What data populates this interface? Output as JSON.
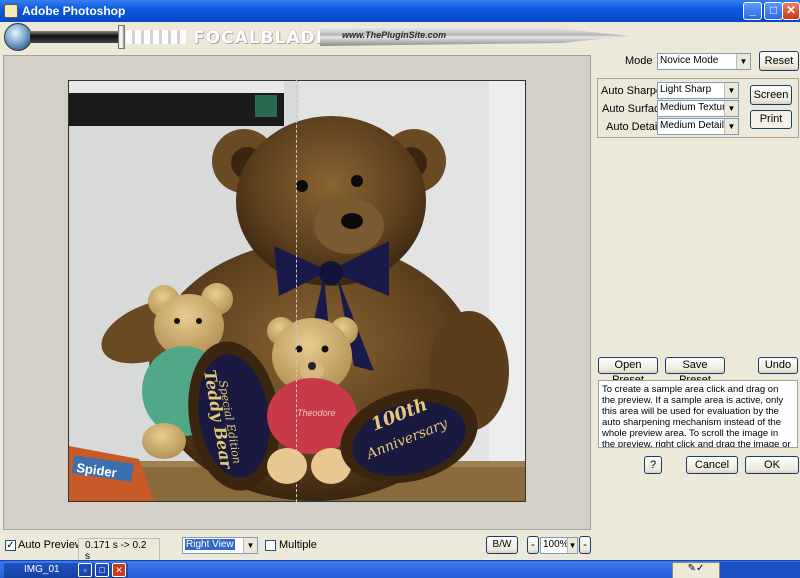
{
  "window": {
    "title": "Adobe Photoshop"
  },
  "banner": {
    "brand": "FOCALBLADE",
    "site": "www.ThePluginSite.com"
  },
  "controls": {
    "mode_label": "Mode",
    "mode_value": "Novice Mode",
    "reset_label": "Reset",
    "auto_sharpen_label": "Auto Sharpen",
    "auto_sharpen_value": "Light Sharp",
    "auto_surface_label": "Auto Surface",
    "auto_surface_value": "Medium Textured",
    "auto_details_label": "Auto Details",
    "auto_details_value": "Medium Details",
    "screen_label": "Screen",
    "print_label": "Print",
    "open_preset_label": "Open Preset",
    "save_preset_label": "Save Preset",
    "undo_label": "Undo",
    "help_label": "?",
    "cancel_label": "Cancel",
    "ok_label": "OK"
  },
  "info_text": "To create a sample area click and drag on the preview. If a sample area is active, only this area will be used for evaluation by the auto sharpening mechanism instead of the whole preview area. To scroll the image in the preview, right click and drag the image or use the Alt key and left click.",
  "photo": {
    "foot_left_text_1": "Special Edition",
    "foot_left_text_2": "Teddy Bear",
    "foot_right_text_1": "100th",
    "foot_right_text_2": "Anniversary",
    "shirt_text": "Theodore",
    "book_text": "Spider"
  },
  "bottom": {
    "auto_preview_label": "Auto Preview",
    "auto_preview_checked": true,
    "timing": "0.171 s -> 0.2 s",
    "view_value": "Right View",
    "multiple_label": "Multiple",
    "multiple_checked": false,
    "bw_label": "B/W",
    "zoom_minus": "-",
    "zoom_value": "100%",
    "zoom_plus": "-"
  },
  "taskbar": {
    "task_label": "IMG_01"
  },
  "colors": {
    "titlebar": "#0a5ae0",
    "face": "#ece9d8",
    "taskbar": "#245ed8"
  },
  "icons": [
    "photoshop-icon",
    "minimize-icon",
    "maximize-icon",
    "close-icon",
    "chevron-down-icon",
    "checkmark-icon"
  ]
}
